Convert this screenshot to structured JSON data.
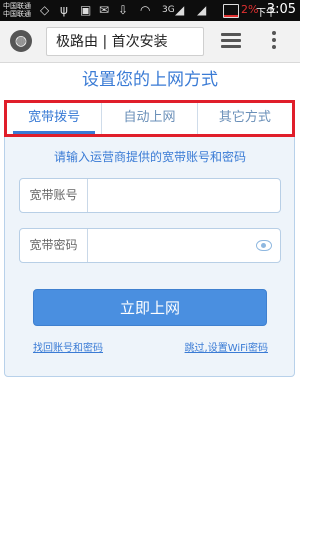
{
  "status_bar": {
    "carrier_top": "中国联通",
    "carrier_bottom": "中国联通",
    "network_label": "3G",
    "battery_percent": "2%",
    "ampm": "下午",
    "time": "3:05"
  },
  "browser": {
    "url_text": "极路由 | 首次安装"
  },
  "page": {
    "title": "设置您的上网方式",
    "tabs": [
      {
        "label": "宽带拨号",
        "active": true
      },
      {
        "label": "自动上网",
        "active": false
      },
      {
        "label": "其它方式",
        "active": false
      }
    ],
    "hint": "请输入运营商提供的宽带账号和密码",
    "account_label": "宽带账号",
    "account_value": "",
    "password_label": "宽带密码",
    "password_value": "",
    "submit_label": "立即上网",
    "link_recover": "找回账号和密码",
    "link_skip": "跳过,设置WiFi密码"
  },
  "colors": {
    "accent": "#3a7bd5",
    "button": "#4a8fe0",
    "highlight_border": "#e01e2a",
    "card_bg": "#eef4fa"
  }
}
